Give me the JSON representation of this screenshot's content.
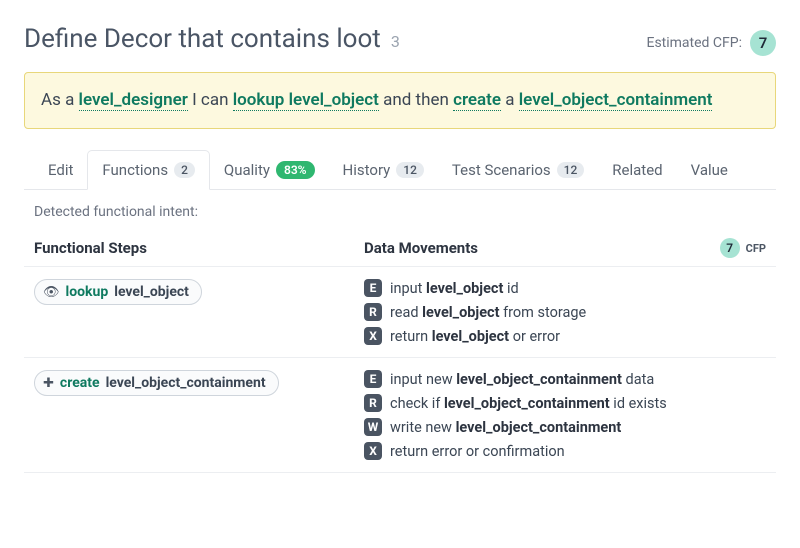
{
  "header": {
    "title": "Define Decor that contains loot",
    "title_num": "3",
    "cfp_label": "Estimated CFP:",
    "cfp_value": "7"
  },
  "story": {
    "t1": "As a ",
    "role": "level_designer",
    "t2": " I can ",
    "a1_verb": "lookup",
    "a1_noun": "level_object",
    "t3": " and then ",
    "a2_verb": "create",
    "t4": " a ",
    "a2_noun": "level_object_containment"
  },
  "tabs": {
    "edit": "Edit",
    "functions": "Functions",
    "functions_count": "2",
    "quality": "Quality",
    "quality_pct": "83%",
    "history": "History",
    "history_count": "12",
    "test": "Test Scenarios",
    "test_count": "12",
    "related": "Related",
    "value": "Value"
  },
  "detected_label": "Detected functional intent:",
  "cols": {
    "steps": "Functional Steps",
    "moves": "Data Movements",
    "cfp_num": "7",
    "cfp_label": "CFP"
  },
  "steps": [
    {
      "verb": "lookup",
      "noun": "level_object",
      "icon": "eye",
      "moves": [
        {
          "l": "E",
          "pre": "input ",
          "bold": "level_object",
          "post": " id"
        },
        {
          "l": "R",
          "pre": "read ",
          "bold": "level_object",
          "post": " from storage"
        },
        {
          "l": "X",
          "pre": "return ",
          "bold": "level_object",
          "post": " or error"
        }
      ]
    },
    {
      "verb": "create",
      "noun": "level_object_containment",
      "icon": "plus",
      "moves": [
        {
          "l": "E",
          "pre": "input new ",
          "bold": "level_object_containment",
          "post": " data"
        },
        {
          "l": "R",
          "pre": "check if ",
          "bold": "level_object_containment",
          "post": " id exists"
        },
        {
          "l": "W",
          "pre": "write new ",
          "bold": "level_object_containment",
          "post": ""
        },
        {
          "l": "X",
          "pre": "return error or confirmation",
          "bold": "",
          "post": ""
        }
      ]
    }
  ]
}
